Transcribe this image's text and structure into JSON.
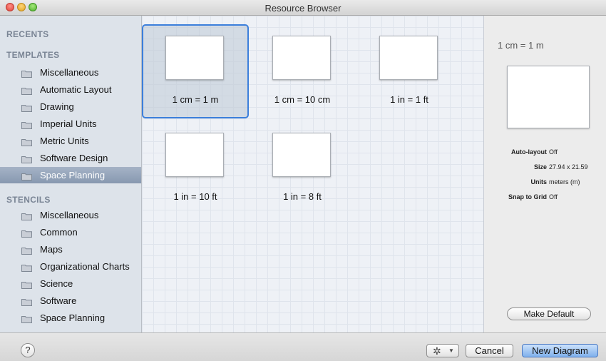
{
  "window": {
    "title": "Resource Browser"
  },
  "sidebar": {
    "recents_header": "RECENTS",
    "templates_header": "TEMPLATES",
    "stencils_header": "STENCILS",
    "templates": [
      {
        "label": "Miscellaneous"
      },
      {
        "label": "Automatic Layout"
      },
      {
        "label": "Drawing"
      },
      {
        "label": "Imperial Units"
      },
      {
        "label": "Metric Units"
      },
      {
        "label": "Software Design"
      },
      {
        "label": "Space Planning",
        "selected": true
      }
    ],
    "stencils": [
      {
        "label": "Miscellaneous"
      },
      {
        "label": "Common"
      },
      {
        "label": "Maps"
      },
      {
        "label": "Organizational Charts"
      },
      {
        "label": "Science"
      },
      {
        "label": "Software"
      },
      {
        "label": "Space Planning"
      }
    ]
  },
  "grid": {
    "tiles": [
      {
        "label": "1 cm = 1 m",
        "selected": true
      },
      {
        "label": "1 cm = 10 cm"
      },
      {
        "label": "1 in = 1 ft"
      },
      {
        "label": "1 in = 10 ft"
      },
      {
        "label": "1 in = 8 ft"
      }
    ]
  },
  "inspector": {
    "title": "1 cm = 1 m",
    "properties": [
      {
        "name": "Auto-layout",
        "value": "Off"
      },
      {
        "name": "Size",
        "value": "27.94 x 21.59"
      },
      {
        "name": "Units",
        "value": "meters (m)"
      },
      {
        "name": "Snap to Grid",
        "value": "Off"
      }
    ],
    "make_default_label": "Make Default"
  },
  "bottom": {
    "help_label": "?",
    "gear_icon": "gear-icon",
    "cancel_label": "Cancel",
    "primary_label": "New Diagram"
  },
  "colors": {
    "accent": "#3c7fdb",
    "sidebar_bg": "#dde3ea",
    "selection": "#8798b0"
  }
}
